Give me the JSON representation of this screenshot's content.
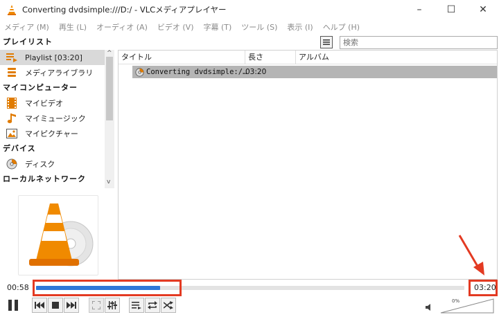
{
  "window": {
    "title": "Converting dvdsimple:///D:/ - VLCメディアプレイヤー",
    "minimize_glyph": "–",
    "maximize_glyph": "☐",
    "close_glyph": "✕"
  },
  "menu": [
    "メディア (M)",
    "再生 (L)",
    "オーディオ (A)",
    "ビデオ (V)",
    "字幕 (T)",
    "ツール (S)",
    "表示 (I)",
    "ヘルプ (H)"
  ],
  "sidebar": {
    "playlist_header": "プレイリスト",
    "playlist_item": "Playlist [03:20]",
    "media_library": "メディアライブラリ",
    "my_computer_header": "マイコンピューター",
    "my_video": "マイビデオ",
    "my_music": "マイミュージック",
    "my_pictures": "マイピクチャー",
    "devices_header": "デバイス",
    "disc": "ディスク",
    "local_network_header": "ローカルネットワーク"
  },
  "search": {
    "placeholder": "検索"
  },
  "playlist": {
    "columns": [
      "タイトル",
      "長さ",
      "アルバム"
    ],
    "rows": [
      {
        "title": "Converting dvdsimple:/…",
        "duration": "03:20",
        "album": ""
      }
    ]
  },
  "player": {
    "elapsed": "00:58",
    "total": "03:20",
    "progress_fraction": 0.29,
    "volume_label": "0%"
  },
  "colors": {
    "accent_blue": "#2f78d8",
    "highlight_red": "#e33a22",
    "vlc_orange": "#f08a00"
  }
}
